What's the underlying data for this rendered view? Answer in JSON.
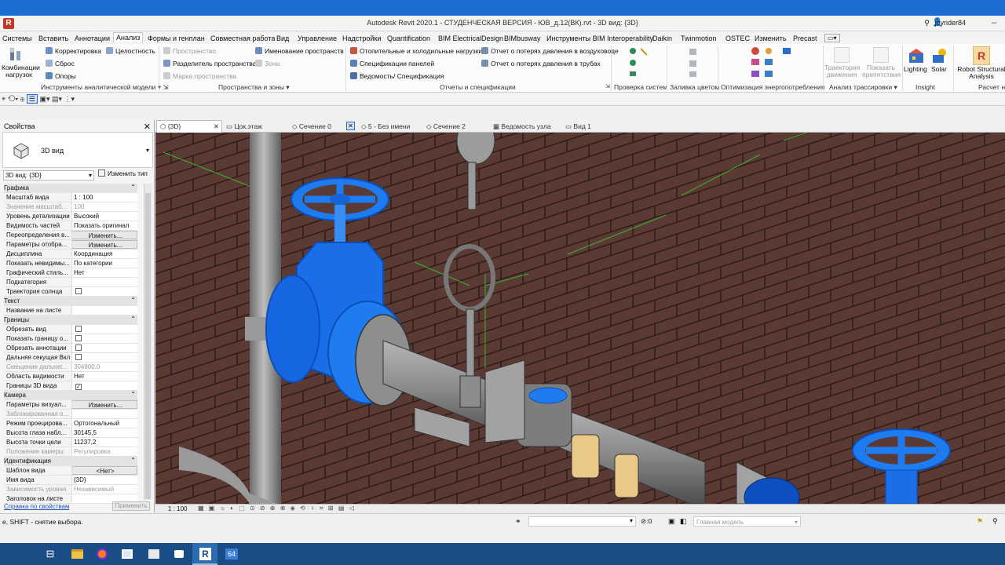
{
  "window": {
    "title": "Autodesk Revit 2020.1 - СТУДЕНЧЕСКАЯ ВЕРСИЯ - ЮВ_д.12(ВК).rvt - 3D вид: {3D}",
    "user": "joyrider84"
  },
  "menu": {
    "items": [
      "Системы",
      "Вставить",
      "Аннотации",
      "Анализ",
      "Формы и генплан",
      "Совместная работа",
      "Вид",
      "Управление",
      "Надстройки",
      "Quantification",
      "BIM ElectricalDesign",
      "BIMbusway",
      "Инструменты BIM Interoperability",
      "Daikin",
      "Twinmotion",
      "OSTEC",
      "Изменить",
      "Precast"
    ],
    "active": "Анализ"
  },
  "ribbon": {
    "combine": "Комбинации нагрузок",
    "correct": "Корректировка",
    "integrity": "Целостность",
    "reset": "Сброс",
    "supports": "Опоры",
    "space": "Пространство",
    "space_sep": "Разделитель пространства",
    "space_tag": "Марка пространства",
    "space_naming": "Именование пространств",
    "zone": "Зона",
    "heating": "Отопительные и холодильные нагрузки",
    "panel_spec": "Спецификации панелей",
    "schedule": "Ведомость/ Спецификация",
    "duct_loss": "Отчет о потерях давления в воздуховоде",
    "pipe_loss": "Отчет о потерях давления в трубах",
    "route": "Траектория движения",
    "show_obst": "Показать препятствия",
    "lighting": "Lighting",
    "solar": "Solar",
    "robot": "Robot Structural Analysis",
    "groups": {
      "analytical": "Инструменты аналитической модели",
      "spaces": "Пространства и зоны",
      "reports": "Отчеты и спецификации",
      "check": "Проверка систем",
      "color": "Заливка цветом",
      "energy": "Оптимизация энергопотребления",
      "route_an": "Анализ трассировки",
      "insight": "Insight",
      "calc": "Расчет н"
    }
  },
  "properties": {
    "title": "Свойства",
    "type_name": "3D вид",
    "selector": "3D вид: {3D}",
    "edit_type": "Изменить тип",
    "rows": [
      {
        "k": "Графика",
        "sec": true
      },
      {
        "k": "Масштаб вида",
        "v": "1 : 100"
      },
      {
        "k": "Значение масштаб...",
        "v": "100",
        "dim": true
      },
      {
        "k": "Уровень детализации",
        "v": "Высокий"
      },
      {
        "k": "Видимость частей",
        "v": "Показать оригинал"
      },
      {
        "k": "Переопределения в...",
        "v": "Изменить...",
        "btn": true
      },
      {
        "k": "Параметры отобра...",
        "v": "Изменить...",
        "btn": true
      },
      {
        "k": "Дисциплина",
        "v": "Координация"
      },
      {
        "k": "Показать невидимы...",
        "v": "По категории"
      },
      {
        "k": "Графический стиль...",
        "v": "Нет"
      },
      {
        "k": "Подкатегория",
        "v": ""
      },
      {
        "k": "Траектория солнца",
        "cb": "unchecked"
      },
      {
        "k": "Текст",
        "sec": true
      },
      {
        "k": "Название на листе",
        "v": ""
      },
      {
        "k": "Границы",
        "sec": true
      },
      {
        "k": "Обрезать вид",
        "cb": "unchecked"
      },
      {
        "k": "Показать границу о...",
        "cb": "unchecked"
      },
      {
        "k": "Обрезать аннотации",
        "cb": "unchecked"
      },
      {
        "k": "Дальняя секущая Вкл",
        "cb": "unchecked"
      },
      {
        "k": "Смещение дальнег...",
        "v": "304800,0",
        "dim": true
      },
      {
        "k": "Область видимости",
        "v": "Нет"
      },
      {
        "k": "Границы 3D вида",
        "cb": "checked"
      },
      {
        "k": "Камера",
        "sec": true
      },
      {
        "k": "Параметры визуал...",
        "v": "Изменить...",
        "btn": true
      },
      {
        "k": "Заблокированная о...",
        "v": "",
        "dim": true
      },
      {
        "k": "Режим проецирова...",
        "v": "Ортогональный"
      },
      {
        "k": "Высота глаза набл...",
        "v": "30145,5"
      },
      {
        "k": "Высота точки цели",
        "v": "11237,2"
      },
      {
        "k": "Положение камеры",
        "v": "Регулировка",
        "dim": true
      },
      {
        "k": "Идентификация",
        "sec": true
      },
      {
        "k": "Шаблон вида",
        "v": "<Нет>",
        "btn": true
      },
      {
        "k": "Имя вида",
        "v": "{3D}"
      },
      {
        "k": "Зависимость уровня",
        "v": "Независимый",
        "dim": true
      },
      {
        "k": "Заголовок на листе",
        "v": ""
      }
    ],
    "help": "Справка по свойствам",
    "apply": "Применить"
  },
  "tabs": [
    "{3D}",
    "Цок.этаж",
    "Сечение 0",
    "5 - Без имени",
    "Сечение 2",
    "Ведомость узла",
    "Вид 1"
  ],
  "viewbar": {
    "scale": "1 : 100"
  },
  "status": {
    "hint": "е, SHIFT - снятие выбора.",
    "model": "Главная модель",
    "count": ":0"
  },
  "colors": {
    "brick": "#5a3a33",
    "valve": "#2277ff",
    "pipe": "#8c8c8c",
    "ribbon_bg": "#fbfbfb",
    "accent": "#1c6fd0"
  }
}
